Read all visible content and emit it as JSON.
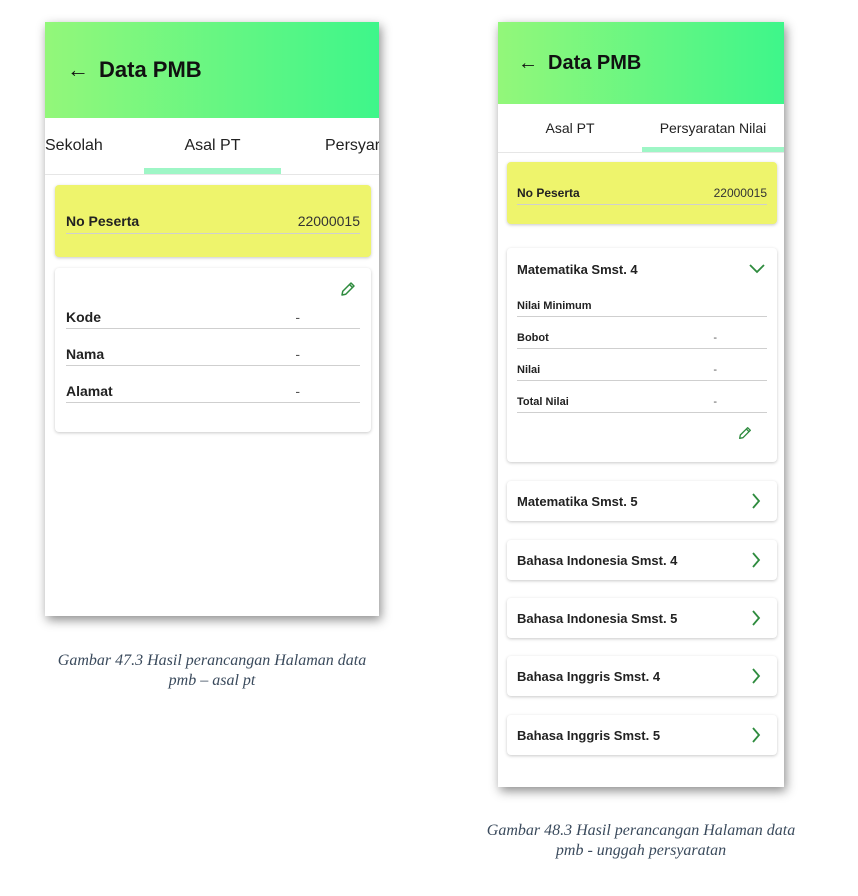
{
  "screen1": {
    "title": "Data PMB",
    "tabs": [
      "Sekolah",
      "Asal PT",
      "Persyar"
    ],
    "active_tab": "Asal PT",
    "peserta": {
      "label": "No Peserta",
      "value": "22000015"
    },
    "fields": [
      {
        "label": "Kode",
        "value": "-"
      },
      {
        "label": "Nama",
        "value": "-"
      },
      {
        "label": "Alamat",
        "value": "-"
      }
    ]
  },
  "caption1": [
    "Gambar 47.3 Hasil perancangan Halaman data",
    "pmb – asal pt"
  ],
  "screen2": {
    "title": "Data PMB",
    "tabs": [
      "Asal PT",
      "Persyaratan Nilai"
    ],
    "active_tab": "Persyaratan Nilai",
    "peserta": {
      "label": "No Peserta",
      "value": "22000015"
    },
    "expanded": {
      "title": "Matematika Smst. 4",
      "fields": [
        {
          "label": "Nilai Minimum",
          "value": ""
        },
        {
          "label": "Bobot",
          "value": "-"
        },
        {
          "label": "Nilai",
          "value": "-"
        },
        {
          "label": "Total Nilai",
          "value": "-"
        }
      ]
    },
    "collapsed": [
      "Matematika Smst. 5",
      "Bahasa Indonesia Smst. 4",
      "Bahasa Indonesia Smst. 5",
      "Bahasa Inggris Smst. 4",
      "Bahasa Inggris Smst. 5"
    ]
  },
  "caption2": [
    "Gambar 48.3 Hasil perancangan Halaman data",
    "pmb - unggah persyaratan"
  ],
  "colors": {
    "accent_green": "#3ef68a",
    "highlight_yellow": "#eef46c",
    "icon_green": "#2e8b3e"
  }
}
